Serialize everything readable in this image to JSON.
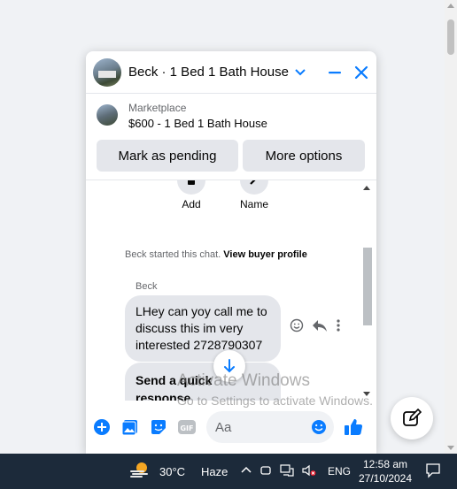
{
  "chat": {
    "title": "Beck · 1 Bed 1 Bath House",
    "listing": {
      "category": "Marketplace",
      "title": "$600 - 1 Bed 1 Bath House"
    },
    "buttons": {
      "pending": "Mark as pending",
      "more": "More options"
    },
    "quick_actions": {
      "add": "Add",
      "name": "Name"
    },
    "started_text": "Beck started this chat. ",
    "view_profile": "View buyer profile",
    "sender": "Beck",
    "message": "LHey can yoy call me to discuss this im very interested 2728790307",
    "quick_reply": "Send a quick response",
    "composer_placeholder": "Aa"
  },
  "watermark": {
    "title": "Activate Windows",
    "subtitle": "Go to Settings to activate Windows."
  },
  "taskbar": {
    "temperature": "30°C",
    "weather": "Haze",
    "language": "ENG",
    "time": "12:58 am",
    "date": "27/10/2024"
  },
  "colors": {
    "accent": "#0a7cff",
    "taskbar": "#1c2a3a",
    "bubble": "#e4e6eb"
  }
}
